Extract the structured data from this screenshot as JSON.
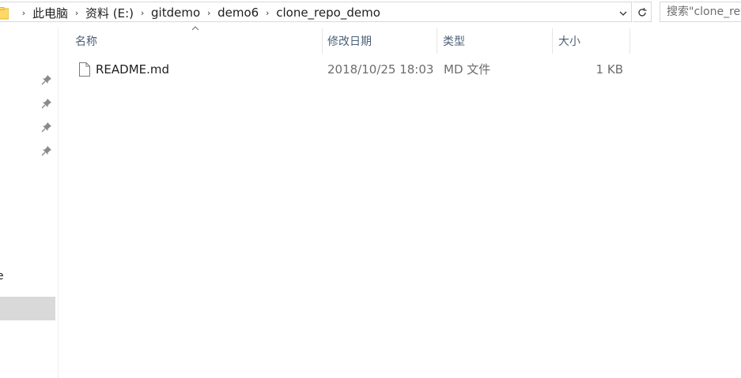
{
  "breadcrumb": {
    "folder_icon": "folder-icon",
    "items": [
      "此电脑",
      "资料 (E:)",
      "gitdemo",
      "demo6",
      "clone_repo_demo"
    ]
  },
  "search": {
    "placeholder": "搜索\"clone_repo_demo\""
  },
  "nav": {
    "partial_label": "e"
  },
  "columns": {
    "name": "名称",
    "date": "修改日期",
    "type": "类型",
    "size": "大小"
  },
  "files": [
    {
      "name": "README.md",
      "date": "2018/10/25 18:03",
      "type": "MD 文件",
      "size": "1 KB",
      "icon": "file-icon"
    }
  ],
  "colors": {
    "header_text": "#4c607a",
    "secondary_text": "#6d6d6d",
    "selection": "#d9d9d9",
    "folder": "#ffd866"
  }
}
